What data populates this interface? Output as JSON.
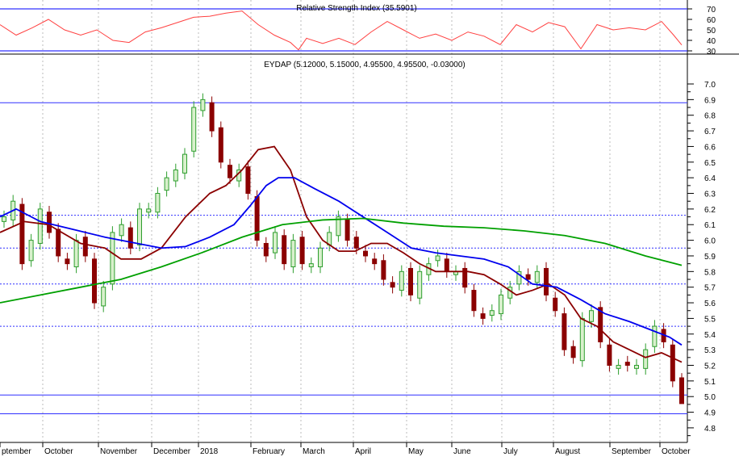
{
  "chart_data": [
    {
      "type": "line",
      "title": "Relative Strength Index (35.5901)",
      "ylim": [
        30,
        70
      ],
      "yticks": [
        "70",
        "60",
        "50",
        "40",
        "30"
      ],
      "ref_levels": [
        70,
        30
      ],
      "series": [
        {
          "name": "RSI",
          "color": "#ff4040",
          "points": [
            [
              0,
              55
            ],
            [
              20,
              45
            ],
            [
              40,
              52
            ],
            [
              60,
              60
            ],
            [
              80,
              50
            ],
            [
              100,
              45
            ],
            [
              120,
              50
            ],
            [
              140,
              40
            ],
            [
              160,
              38
            ],
            [
              180,
              48
            ],
            [
              200,
              52
            ],
            [
              220,
              57
            ],
            [
              240,
              62
            ],
            [
              260,
              63
            ],
            [
              280,
              66
            ],
            [
              300,
              68
            ],
            [
              320,
              55
            ],
            [
              340,
              45
            ],
            [
              360,
              38
            ],
            [
              370,
              31
            ],
            [
              380,
              42
            ],
            [
              400,
              37
            ],
            [
              420,
              42
            ],
            [
              440,
              36
            ],
            [
              460,
              48
            ],
            [
              480,
              58
            ],
            [
              500,
              50
            ],
            [
              520,
              42
            ],
            [
              540,
              46
            ],
            [
              560,
              40
            ],
            [
              580,
              48
            ],
            [
              600,
              44
            ],
            [
              620,
              36
            ],
            [
              640,
              55
            ],
            [
              660,
              48
            ],
            [
              680,
              57
            ],
            [
              700,
              53
            ],
            [
              720,
              32
            ],
            [
              740,
              55
            ],
            [
              760,
              50
            ],
            [
              780,
              52
            ],
            [
              800,
              50
            ],
            [
              820,
              58
            ],
            [
              835,
              45
            ],
            [
              845,
              35.59
            ]
          ]
        }
      ]
    },
    {
      "type": "candlestick",
      "title": "EYDAP (5.12000, 5.15000, 4.95500, 4.95500, -0.03000)",
      "ylim": [
        4.75,
        7.1
      ],
      "yticks": [
        "7.0",
        "6.9",
        "6.8",
        "6.7",
        "6.6",
        "6.5",
        "6.4",
        "6.3",
        "6.2",
        "6.1",
        "6.0",
        "5.9",
        "5.8",
        "5.7",
        "5.6",
        "5.5",
        "5.4",
        "5.3",
        "5.2",
        "5.1",
        "5.0",
        "4.9",
        "4.8"
      ],
      "xlabels": [
        "ptember",
        "October",
        "November",
        "December",
        "2018",
        "February",
        "March",
        "April",
        "May",
        "June",
        "July",
        "August",
        "September",
        "October"
      ],
      "x_domain_note": "x values are trading-session index units (0-850)",
      "closes": [
        6.15,
        6.25,
        5.85,
        6.0,
        6.2,
        6.05,
        5.9,
        5.85,
        6.0,
        5.9,
        5.6,
        5.7,
        6.05,
        6.1,
        5.95,
        6.2,
        6.2,
        6.3,
        6.4,
        6.45,
        6.55,
        6.85,
        6.9,
        6.7,
        6.5,
        6.4,
        6.45,
        6.3,
        6.0,
        5.9,
        6.05,
        5.85,
        6.0,
        5.85,
        5.85,
        5.95,
        6.05,
        6.15,
        6.0,
        5.95,
        5.9,
        5.85,
        5.75,
        5.7,
        5.8,
        5.65,
        5.8,
        5.85,
        5.9,
        5.8,
        5.8,
        5.7,
        5.55,
        5.5,
        5.55,
        5.65,
        5.7,
        5.8,
        5.75,
        5.8,
        5.65,
        5.55,
        5.3,
        5.25,
        5.5,
        5.55,
        5.35,
        5.2,
        5.2,
        5.2,
        5.2,
        5.3,
        5.45,
        5.35,
        5.1,
        4.955
      ],
      "last_bar": {
        "open": 5.12,
        "high": 5.15,
        "low": 4.955,
        "close": 4.955,
        "change": -0.03
      },
      "solid_levels": [
        6.88,
        5.01,
        4.89
      ],
      "dotted_levels": [
        6.16,
        5.95,
        5.72,
        5.45
      ],
      "moving_averages": [
        {
          "name": "short MA",
          "color": "#8b0000",
          "points": [
            [
              0,
              6.05
            ],
            [
              30,
              6.12
            ],
            [
              60,
              6.1
            ],
            [
              100,
              5.98
            ],
            [
              130,
              5.95
            ],
            [
              150,
              5.88
            ],
            [
              175,
              5.88
            ],
            [
              200,
              5.95
            ],
            [
              230,
              6.15
            ],
            [
              260,
              6.3
            ],
            [
              280,
              6.35
            ],
            [
              300,
              6.45
            ],
            [
              320,
              6.58
            ],
            [
              340,
              6.6
            ],
            [
              360,
              6.45
            ],
            [
              380,
              6.15
            ],
            [
              400,
              6.0
            ],
            [
              420,
              5.93
            ],
            [
              440,
              5.93
            ],
            [
              460,
              5.98
            ],
            [
              480,
              5.98
            ],
            [
              500,
              5.92
            ],
            [
              520,
              5.85
            ],
            [
              540,
              5.8
            ],
            [
              560,
              5.8
            ],
            [
              580,
              5.8
            ],
            [
              600,
              5.78
            ],
            [
              620,
              5.72
            ],
            [
              640,
              5.65
            ],
            [
              660,
              5.68
            ],
            [
              680,
              5.72
            ],
            [
              700,
              5.65
            ],
            [
              720,
              5.5
            ],
            [
              740,
              5.45
            ],
            [
              760,
              5.35
            ],
            [
              780,
              5.3
            ],
            [
              800,
              5.25
            ],
            [
              820,
              5.28
            ],
            [
              845,
              5.22
            ]
          ]
        },
        {
          "name": "medium MA",
          "color": "#0000ee",
          "points": [
            [
              0,
              6.15
            ],
            [
              20,
              6.2
            ],
            [
              50,
              6.12
            ],
            [
              90,
              6.07
            ],
            [
              130,
              6.02
            ],
            [
              170,
              5.98
            ],
            [
              200,
              5.95
            ],
            [
              230,
              5.96
            ],
            [
              260,
              6.02
            ],
            [
              290,
              6.1
            ],
            [
              310,
              6.22
            ],
            [
              330,
              6.35
            ],
            [
              345,
              6.4
            ],
            [
              365,
              6.4
            ],
            [
              390,
              6.33
            ],
            [
              420,
              6.25
            ],
            [
              450,
              6.15
            ],
            [
              480,
              6.05
            ],
            [
              510,
              5.95
            ],
            [
              540,
              5.92
            ],
            [
              570,
              5.9
            ],
            [
              600,
              5.88
            ],
            [
              630,
              5.83
            ],
            [
              660,
              5.72
            ],
            [
              690,
              5.7
            ],
            [
              720,
              5.62
            ],
            [
              750,
              5.53
            ],
            [
              780,
              5.48
            ],
            [
              810,
              5.42
            ],
            [
              830,
              5.38
            ],
            [
              845,
              5.33
            ]
          ]
        },
        {
          "name": "long MA",
          "color": "#00a000",
          "points": [
            [
              0,
              5.6
            ],
            [
              50,
              5.65
            ],
            [
              100,
              5.7
            ],
            [
              150,
              5.75
            ],
            [
              200,
              5.83
            ],
            [
              250,
              5.92
            ],
            [
              300,
              6.02
            ],
            [
              350,
              6.1
            ],
            [
              400,
              6.13
            ],
            [
              450,
              6.14
            ],
            [
              500,
              6.11
            ],
            [
              550,
              6.09
            ],
            [
              600,
              6.08
            ],
            [
              650,
              6.06
            ],
            [
              700,
              6.03
            ],
            [
              750,
              5.98
            ],
            [
              800,
              5.9
            ],
            [
              845,
              5.84
            ]
          ]
        }
      ]
    }
  ]
}
